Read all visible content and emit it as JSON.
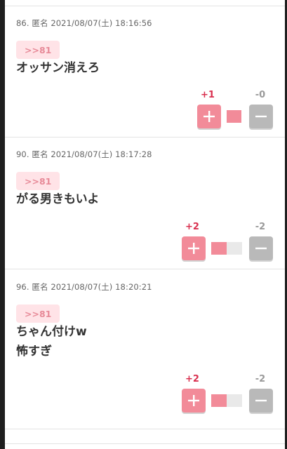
{
  "comments": [
    {
      "number": "86.",
      "name": "匿名",
      "datetime": "2021/08/07(土) 18:16:56",
      "anchor": ">>81",
      "lines": [
        "オッサン消えろ"
      ],
      "plus_count": "+1",
      "minus_count": "-0",
      "plus_ratio": 1.0
    },
    {
      "number": "90.",
      "name": "匿名",
      "datetime": "2021/08/07(土) 18:17:28",
      "anchor": ">>81",
      "lines": [
        "がる男きもいよ"
      ],
      "plus_count": "+2",
      "minus_count": "-2",
      "plus_ratio": 0.5
    },
    {
      "number": "96.",
      "name": "匿名",
      "datetime": "2021/08/07(土) 18:20:21",
      "anchor": ">>81",
      "lines": [
        "ちゃん付けw",
        "怖すぎ"
      ],
      "plus_count": "+2",
      "minus_count": "-2",
      "plus_ratio": 0.5
    }
  ],
  "icons": {
    "plus": "plus-icon",
    "minus": "minus-icon"
  },
  "colors": {
    "plus": "#f28b99",
    "minus": "#b9b9b9",
    "plus_count": "#d9304f",
    "anchor_bg": "#ffe3e7"
  }
}
